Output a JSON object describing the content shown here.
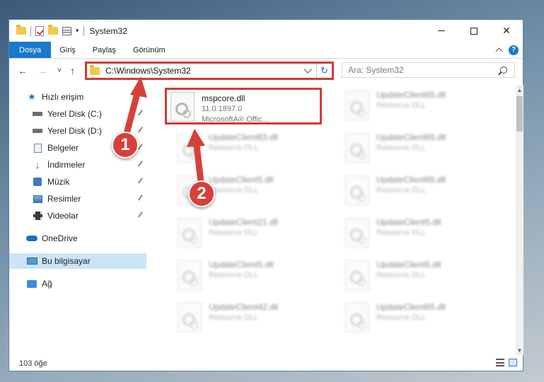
{
  "window": {
    "title": "System32",
    "controls": {
      "minimize": "—",
      "maximize": "☐",
      "close": "✕"
    }
  },
  "ribbon": {
    "tabs": [
      {
        "label": "Dosya",
        "active": true
      },
      {
        "label": "Giriş",
        "active": false
      },
      {
        "label": "Paylaş",
        "active": false
      },
      {
        "label": "Görünüm",
        "active": false
      }
    ],
    "help": "?"
  },
  "nav": {
    "back": "←",
    "forward": "→",
    "recent": "˅",
    "up": "↑",
    "address": "C:\\Windows\\System32",
    "refresh": "↻",
    "search_placeholder": "Ara: System32"
  },
  "sidebar": {
    "items": [
      {
        "label": "Hızlı erişim",
        "icon": "star-icon"
      },
      {
        "label": "Yerel Disk (C:)",
        "icon": "drive-icon",
        "pinned": true
      },
      {
        "label": "Yerel Disk (D:)",
        "icon": "drive-icon",
        "pinned": true
      },
      {
        "label": "Belgeler",
        "icon": "documents-icon",
        "pinned": true
      },
      {
        "label": "İndirmeler",
        "icon": "downloads-icon",
        "pinned": true
      },
      {
        "label": "Müzik",
        "icon": "music-icon",
        "pinned": true
      },
      {
        "label": "Resimler",
        "icon": "pictures-icon",
        "pinned": true
      },
      {
        "label": "Videolar",
        "icon": "videos-icon",
        "pinned": true
      },
      {
        "label": "OneDrive",
        "icon": "onedrive-icon"
      },
      {
        "label": "Bu bilgisayar",
        "icon": "this-pc-icon",
        "selected": true
      },
      {
        "label": "Ağ",
        "icon": "network-icon"
      }
    ]
  },
  "files": [
    {
      "name": "mspcore.dll",
      "line2": "11.0.1897.0",
      "line3": "MicrosoftA® Offic...",
      "highlighted": true
    },
    {
      "name": "UpdateClient65.dll",
      "line2": "Resource DLL"
    },
    {
      "name": "UpdateClient63.dll",
      "line2": "Resource DLL"
    },
    {
      "name": "UpdateClient65.dll",
      "line2": "Resource DLL"
    },
    {
      "name": "UpdateClient5.dll",
      "line2": "Resource DLL"
    },
    {
      "name": "UpdateClient65.dll",
      "line2": "Resource DLL"
    },
    {
      "name": "UpdateClient21.dll",
      "line2": "Resource DLL"
    },
    {
      "name": "UpdateClient5.dll",
      "line2": "Resource DLL"
    },
    {
      "name": "UpdateClient5.dll",
      "line2": "Resource DLL"
    },
    {
      "name": "UpdateClient5.dll",
      "line2": "Resource DLL"
    },
    {
      "name": "UpdateClient42.dll",
      "line2": "Resource DLL"
    },
    {
      "name": "UpdateClient65.dll",
      "line2": "Resource DLL"
    }
  ],
  "status": {
    "item_count": "103 öğe"
  },
  "annotations": [
    {
      "number": "1",
      "target": "address-bar"
    },
    {
      "number": "2",
      "target": "selected-file"
    }
  ],
  "colors": {
    "accent": "#1979ca",
    "highlight": "#d23b34",
    "badge": "#d6403a"
  }
}
